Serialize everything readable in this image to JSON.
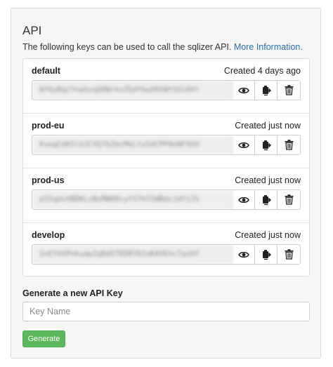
{
  "panel": {
    "title": "API",
    "description": "The following keys can be used to call the sqlizer API.",
    "more_info_link": "More Information."
  },
  "keys": [
    {
      "name": "default",
      "created": "Created 4 days ago",
      "value": "WfOuBqzYnaGvqUHWrkvZGdYkwXKhWtSUiAXt"
    },
    {
      "name": "prod-eu",
      "created": "Created just now",
      "value": "KvoqCmKSlk2CXQ7bZmcMeLtuSdCPPAnWFXhU"
    },
    {
      "name": "prod-us",
      "created": "Created just now",
      "value": "pS5qdvXBDKLzBxMW08cyYSYhYIWBdcJdY1JS"
    },
    {
      "name": "develop",
      "created": "Created just now",
      "value": "SnEYVXPnkuqwIqRdSTKDRYDIuKAVEhcTazUY"
    }
  ],
  "generate": {
    "label": "Generate a new API Key",
    "placeholder": "Key Name",
    "button_label": "Generate"
  },
  "icons": {
    "show": "eye-icon",
    "copy": "clipboard-icon",
    "delete": "trash-icon"
  },
  "colors": {
    "link": "#2a6fb0",
    "generate_button": "#5cb85c"
  }
}
